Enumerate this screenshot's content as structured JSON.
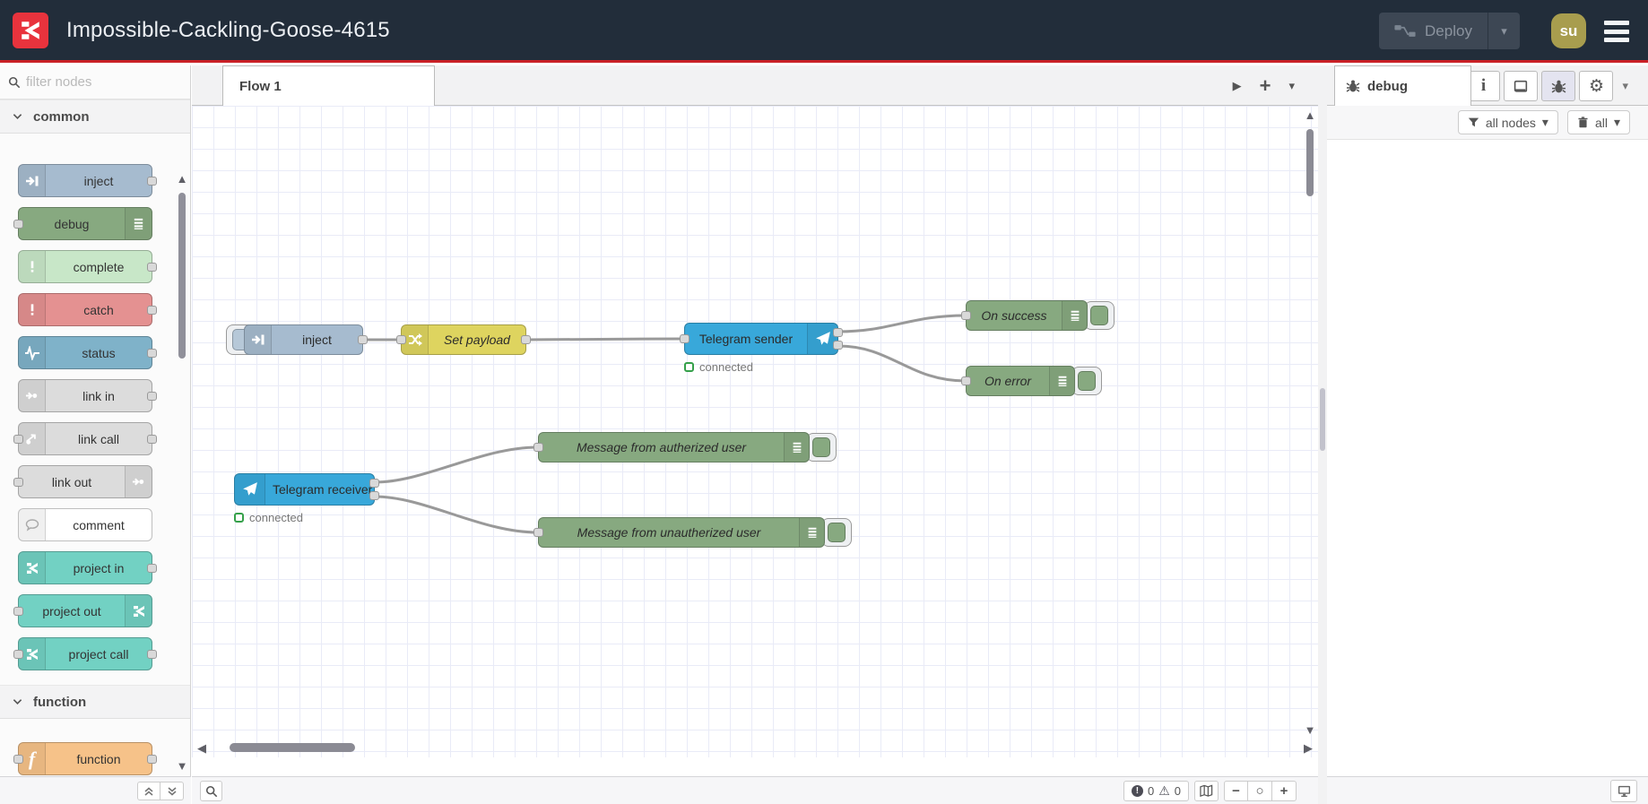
{
  "header": {
    "title": "Impossible-Cackling-Goose-4615",
    "deploy_label": "Deploy",
    "avatar_initials": "su"
  },
  "palette": {
    "search_placeholder": "filter nodes",
    "categories": [
      {
        "label": "common",
        "nodes": [
          {
            "label": "inject"
          },
          {
            "label": "debug"
          },
          {
            "label": "complete"
          },
          {
            "label": "catch"
          },
          {
            "label": "status"
          },
          {
            "label": "link in"
          },
          {
            "label": "link call"
          },
          {
            "label": "link out"
          },
          {
            "label": "comment"
          },
          {
            "label": "project in"
          },
          {
            "label": "project out"
          },
          {
            "label": "project call"
          }
        ]
      },
      {
        "label": "function",
        "nodes": [
          {
            "label": "function"
          }
        ]
      }
    ]
  },
  "workspace": {
    "tab_label": "Flow 1",
    "footer": {
      "error_count": "0",
      "warning_count": "0"
    }
  },
  "flow": {
    "nodes": {
      "inject": "inject",
      "change": "Set payload",
      "sender": "Telegram sender",
      "receiver": "Telegram receiver",
      "on_success": "On success",
      "on_error": "On error",
      "msg_auth": "Message from autherized user",
      "msg_unauth": "Message from unautherized user"
    },
    "sender_status": "connected",
    "receiver_status": "connected"
  },
  "sidebar": {
    "tab_label": "debug",
    "filter_label": "all nodes",
    "clear_label": "all"
  },
  "glyphs": {
    "caret_down": "▾",
    "tri_up": "▲",
    "tri_down": "▼",
    "tri_left": "◀",
    "tri_right": "▶",
    "plus": "+",
    "minus": "−",
    "circle": "○",
    "warning": "⚠",
    "bang": "!",
    "gear": "⚙",
    "info": "i",
    "fn": "f"
  },
  "colors": {
    "header_bg": "#222d3a",
    "accent_red": "#c92127",
    "logo_red": "#e8333d",
    "inject": "#a6bbcf",
    "debug": "#87a980",
    "complete": "#c8e7c8",
    "catch": "#e49191",
    "status": "#7fb2c9",
    "link": "#dcdcdc",
    "project": "#72d1c3",
    "function": "#f6c289",
    "change": "#ded45f",
    "telegram": "#38a8da",
    "status_ok_green": "#35a04a",
    "wire": "#999999",
    "grid": "#e9ebf7",
    "avatar_bg": "#a89d4e"
  }
}
